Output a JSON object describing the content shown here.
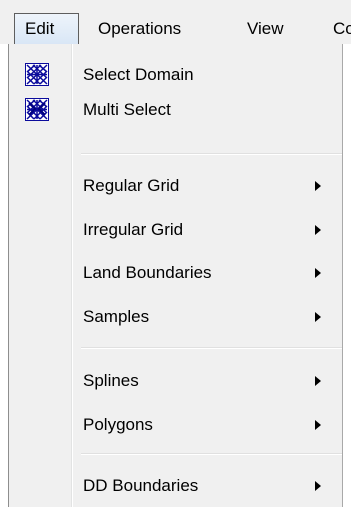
{
  "menubar": {
    "items": [
      "Edit",
      "Operations",
      "View",
      "Co"
    ]
  },
  "menu": {
    "items": [
      {
        "label": "Select Domain",
        "icon": "select-domain-icon",
        "submenu": false
      },
      {
        "label": "Multi Select",
        "icon": "multi-select-icon",
        "submenu": false
      },
      {
        "label": "Regular Grid",
        "submenu": true
      },
      {
        "label": "Irregular Grid",
        "submenu": true
      },
      {
        "label": "Land Boundaries",
        "submenu": true
      },
      {
        "label": "Samples",
        "submenu": true
      },
      {
        "label": "Splines",
        "submenu": true
      },
      {
        "label": "Polygons",
        "submenu": true
      },
      {
        "label": "DD Boundaries",
        "submenu": true
      }
    ]
  },
  "colors": {
    "menu_background": "#f0f0f0",
    "active_menu_background": "#dbe7f6",
    "icon_blue": "#0b0b9c"
  }
}
